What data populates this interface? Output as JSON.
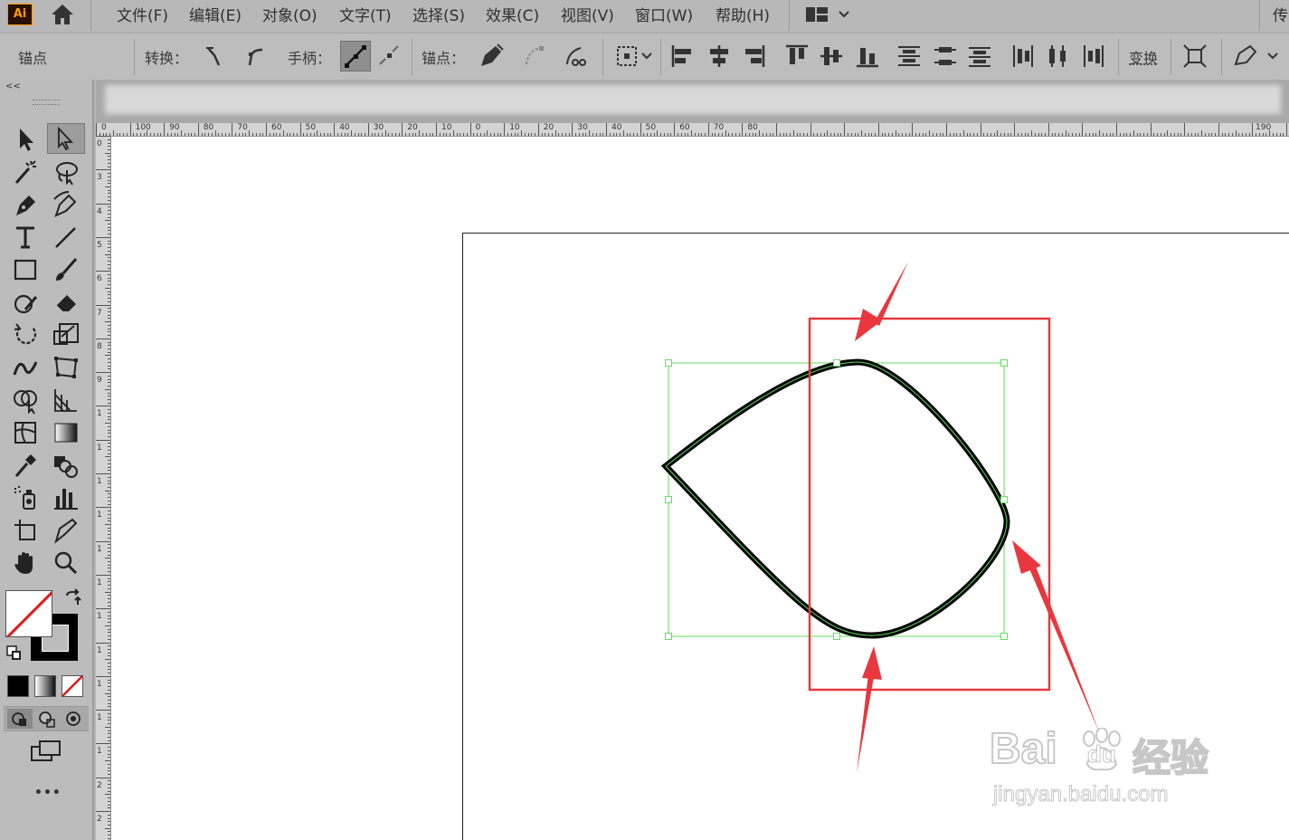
{
  "menubar": {
    "logo": "Ai",
    "items": [
      "文件(F)",
      "编辑(E)",
      "对象(O)",
      "文字(T)",
      "选择(S)",
      "效果(C)",
      "视图(V)",
      "窗口(W)",
      "帮助(H)"
    ],
    "right_text": "传"
  },
  "control_bar": {
    "anchor_label": "锚点",
    "convert_label": "转换：",
    "handles_label": "手柄：",
    "anchors_label": "锚点：",
    "transform_label": "变换"
  },
  "toolbox": {
    "collapse_label": "<<",
    "more_label": "•••"
  },
  "ruler": {
    "top_labels": [
      "0",
      "100",
      "90",
      "80",
      "70",
      "60",
      "50",
      "40",
      "30",
      "20",
      "10",
      "0",
      "10",
      "20",
      "30",
      "40",
      "50",
      "60",
      "70",
      "80",
      "190"
    ],
    "left_labels": [
      "0",
      "3",
      "4",
      "5",
      "6",
      "7",
      "8",
      "9",
      "1",
      "1",
      "1",
      "1",
      "1",
      "1",
      "1",
      "1",
      "1",
      "1",
      "1",
      "2",
      "2"
    ]
  },
  "watermark": {
    "brand": "Bai",
    "brand2": "du",
    "product": "经验",
    "url": "jingyan.baidu.com"
  },
  "colors": {
    "selection_green": "#5ee05e",
    "annotation_red": "#e8383d",
    "logo_orange": "#ff9a00"
  },
  "icons": [
    "home-icon",
    "workspace-icon",
    "selection-tool-icon",
    "direct-selection-tool-icon",
    "magic-wand-icon",
    "lasso-icon",
    "pen-tool-icon",
    "curvature-tool-icon",
    "type-tool-icon",
    "line-tool-icon",
    "rectangle-tool-icon",
    "paintbrush-icon",
    "shaper-icon",
    "eraser-icon",
    "rotate-icon",
    "scale-icon",
    "warp-icon",
    "free-transform-icon",
    "shape-builder-icon",
    "perspective-grid-icon",
    "mesh-icon",
    "gradient-icon",
    "eyedropper-icon",
    "blend-icon",
    "symbol-sprayer-icon",
    "column-graph-icon",
    "artboard-tool-icon",
    "slice-icon",
    "hand-icon",
    "zoom-icon"
  ]
}
